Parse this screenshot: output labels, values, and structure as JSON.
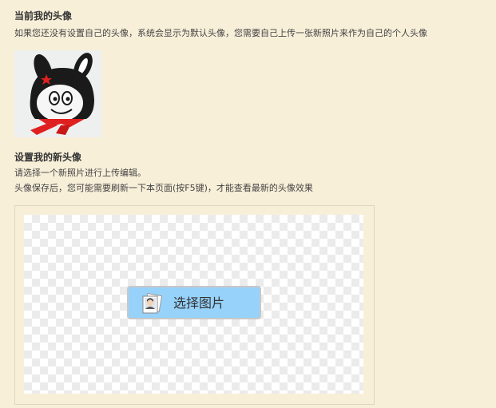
{
  "current_avatar": {
    "title": "当前我的头像",
    "description": "如果您还没有设置自己的头像，系统会显示为默认头像，您需要自己上传一张新照片来作为自己的个人头像"
  },
  "new_avatar": {
    "title": "设置我的新头像",
    "description_line1": "请选择一个新照片进行上传编辑。",
    "description_line2": "头像保存后，您可能需要刷新一下本页面(按F5键)，才能查看最新的头像效果"
  },
  "uploader": {
    "select_button_label": "选择图片",
    "button_color": "#96d2fa"
  }
}
